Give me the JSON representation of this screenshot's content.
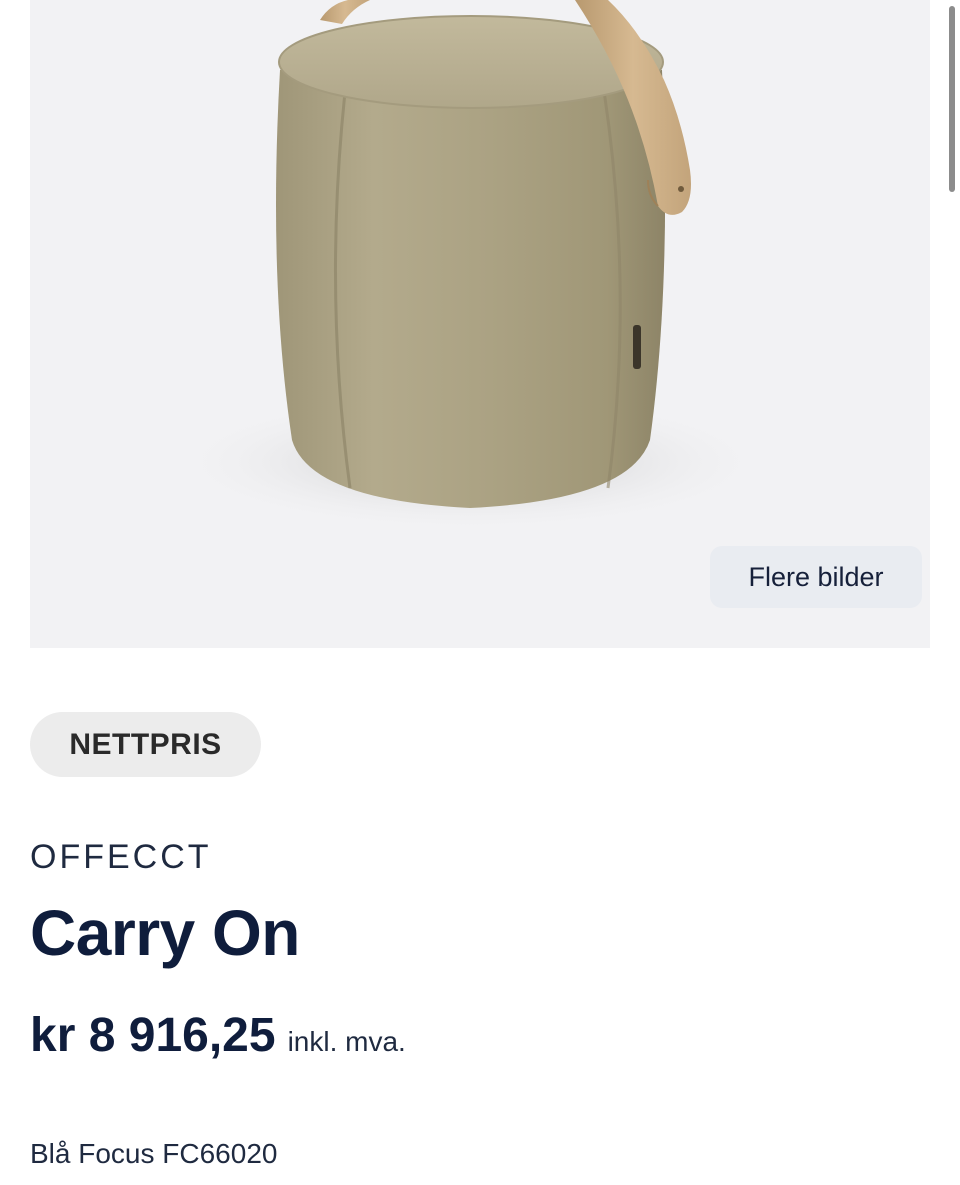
{
  "product": {
    "more_images_label": "Flere bilder",
    "badge": "NETTPRIS",
    "brand": "OFFECCT",
    "title": "Carry On",
    "price": "kr 8 916,25",
    "vat_note": "inkl. mva.",
    "variant": "Blå Focus FC66020"
  },
  "colors": {
    "text_primary": "#0f1d3c",
    "image_background": "#f2f2f4",
    "badge_background": "#ececec",
    "button_background": "#e9ecf1",
    "fabric": "#b3a98a",
    "leather_strap": "#c9ab84"
  }
}
